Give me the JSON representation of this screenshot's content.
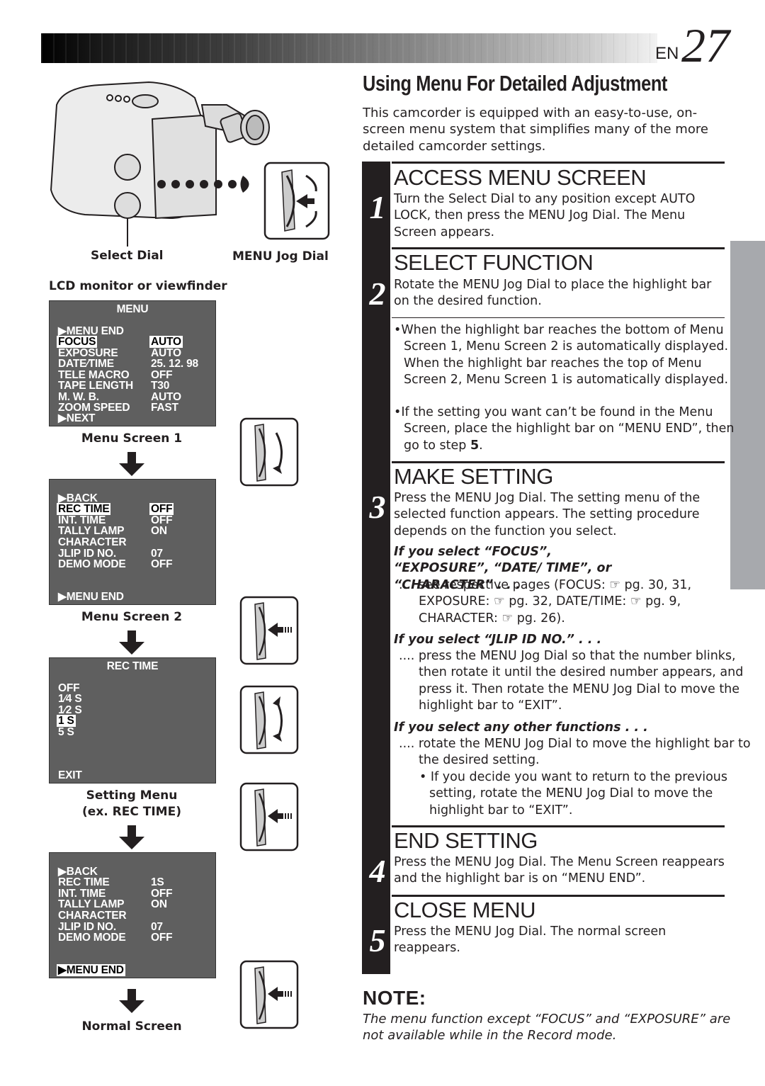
{
  "header": {
    "lang": "EN",
    "page_number": "27"
  },
  "title": "Using Menu For Detailed Adjustment",
  "intro": "This camcorder is equipped with an easy-to-use, on-screen menu system that simplifies many of the more detailed camcorder settings.",
  "figure": {
    "select_dial_label": "Select Dial",
    "menu_jog_dial_label": "MENU Jog Dial",
    "lcd_label": "LCD monitor or viewfinder",
    "menu_screen_1": {
      "title": "MENU",
      "caption": "Menu Screen 1",
      "top_item": "▶MENU  END",
      "rows": [
        {
          "label": "FOCUS",
          "value": "AUTO",
          "highlight": true
        },
        {
          "label": "EXPOSURE",
          "value": "AUTO"
        },
        {
          "label": "DATE∕TIME",
          "value": "25. 12. 98"
        },
        {
          "label": "TELE  MACRO",
          "value": "OFF"
        },
        {
          "label": "TAPE  LENGTH",
          "value": "T30"
        },
        {
          "label": "M. W. B.",
          "value": "AUTO"
        },
        {
          "label": "ZOOM SPEED",
          "value": "FAST"
        }
      ],
      "bottom_item": "▶NEXT"
    },
    "menu_screen_2": {
      "caption": "Menu Screen 2",
      "top_item": "▶BACK",
      "rows": [
        {
          "label": "REC  TIME",
          "value": "OFF",
          "highlight": true
        },
        {
          "label": "INT.  TIME",
          "value": "OFF"
        },
        {
          "label": "TALLY  LAMP",
          "value": "ON"
        },
        {
          "label": "CHARACTER",
          "value": ""
        },
        {
          "label": "JLIP  ID  NO.",
          "value": "07"
        },
        {
          "label": "DEMO  MODE",
          "value": "OFF"
        }
      ],
      "bottom_item": "▶MENU  END"
    },
    "setting_menu": {
      "title": "REC  TIME",
      "caption_line1": "Setting Menu",
      "caption_line2": "(ex. REC TIME)",
      "options": [
        "OFF",
        "1∕4 S",
        "1∕2 S",
        "1  S",
        "5  S"
      ],
      "selected_index": 3,
      "exit": "EXIT"
    },
    "menu_screen_result": {
      "caption": "Normal Screen",
      "top_item": "▶BACK",
      "rows": [
        {
          "label": "REC  TIME",
          "value": "1S"
        },
        {
          "label": "INT.  TIME",
          "value": "OFF"
        },
        {
          "label": "TALLY  LAMP",
          "value": "ON"
        },
        {
          "label": "CHARACTER",
          "value": ""
        },
        {
          "label": "JLIP  ID  NO.",
          "value": "07"
        },
        {
          "label": "DEMO  MODE",
          "value": "OFF"
        }
      ],
      "bottom_item": "▶MENU  END"
    }
  },
  "steps": [
    {
      "num": "1",
      "heading": "ACCESS MENU SCREEN",
      "text": "Turn the Select Dial to any position except AUTO LOCK, then press the MENU Jog Dial. The Menu Screen appears."
    },
    {
      "num": "2",
      "heading": "SELECT FUNCTION",
      "text": "Rotate the MENU Jog Dial to place the highlight bar on the desired function.",
      "bullets": [
        "When the highlight bar reaches the bottom of Menu Screen 1, Menu Screen 2 is automatically displayed. When the highlight bar reaches the top of Menu Screen 2, Menu Screen 1 is automatically displayed.",
        "If the setting you want can’t be found in the Menu Screen, place the highlight bar on “MENU END”, then go to step "
      ],
      "bullet_step_ref": "5",
      "bullet_end": "."
    },
    {
      "num": "3",
      "heading": "MAKE SETTING",
      "text": "Press the MENU Jog Dial. The setting menu of the selected function appears. The setting procedure depends on the function you select.",
      "cases": [
        {
          "title": "If you select “FOCUS”, “EXPOSURE”, “DATE/ TIME”, or “CHARACTER” . . .",
          "text": ".... see respective pages (FOCUS: ☞ pg. 30, 31, EXPOSURE: ☞ pg. 32, DATE/TIME: ☞ pg. 9, CHARACTER: ☞ pg. 26)."
        },
        {
          "title": "If you select “JLIP ID NO.” . . .",
          "text": ".... press the MENU Jog Dial so that the number blinks, then rotate it until the desired number appears, and press it. Then rotate the MENU Jog Dial to move the highlight bar to “EXIT”."
        },
        {
          "title": "If you select any other functions . . .",
          "text": ".... rotate the MENU Jog Dial to move the highlight bar to the desired setting.",
          "bullet": "If you decide you want to return to the previous setting, rotate the MENU Jog Dial to move the highlight bar to “EXIT”."
        }
      ]
    },
    {
      "num": "4",
      "heading": "END SETTING",
      "text": "Press the MENU Jog Dial. The Menu Screen reappears and the highlight bar is on “MENU END”."
    },
    {
      "num": "5",
      "heading": "CLOSE MENU",
      "text": "Press the MENU Jog Dial. The normal screen reappears."
    }
  ],
  "note": {
    "heading": "NOTE:",
    "text": "The menu function except “FOCUS” and “EXPOSURE” are not available while in the Record mode."
  },
  "colors": {
    "ink": "#231f20",
    "osd_background": "#5f5f5f",
    "side_tab": "#a7a9ad"
  }
}
